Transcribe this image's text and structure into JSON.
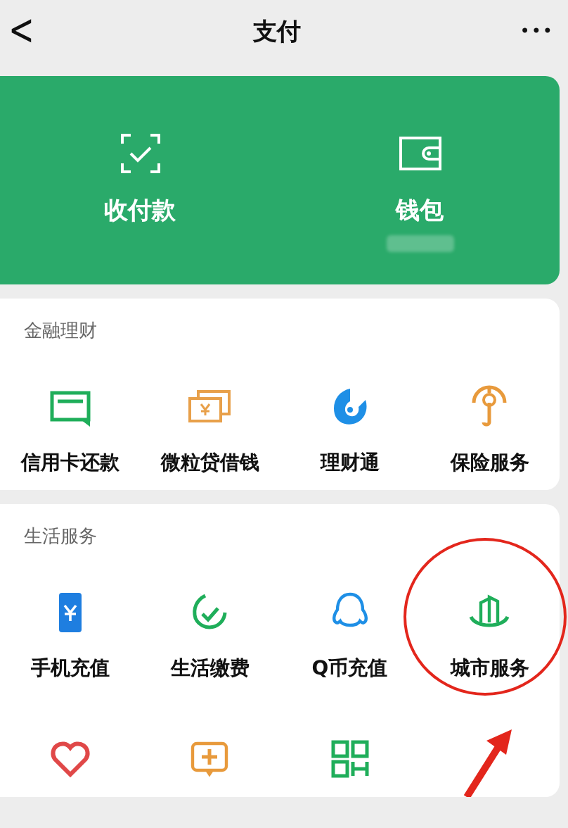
{
  "header": {
    "back": "<",
    "title": "支付",
    "more": "•••"
  },
  "top_card": {
    "items": [
      {
        "label": "收付款"
      },
      {
        "label": "钱包",
        "balance_blurred": true
      }
    ]
  },
  "sections": [
    {
      "title": "金融理财",
      "items": [
        {
          "label": "信用卡还款",
          "highlighted": false
        },
        {
          "label": "微粒贷借钱",
          "highlighted": false
        },
        {
          "label": "理财通",
          "highlighted": false
        },
        {
          "label": "保险服务",
          "highlighted": false
        }
      ]
    },
    {
      "title": "生活服务",
      "items": [
        {
          "label": "手机充值",
          "highlighted": false
        },
        {
          "label": "生活缴费",
          "highlighted": false
        },
        {
          "label": "Q币充值",
          "highlighted": false
        },
        {
          "label": "城市服务",
          "highlighted": true
        },
        {
          "highlighted": false
        },
        {
          "highlighted": false
        },
        {
          "highlighted": false
        }
      ]
    }
  ]
}
